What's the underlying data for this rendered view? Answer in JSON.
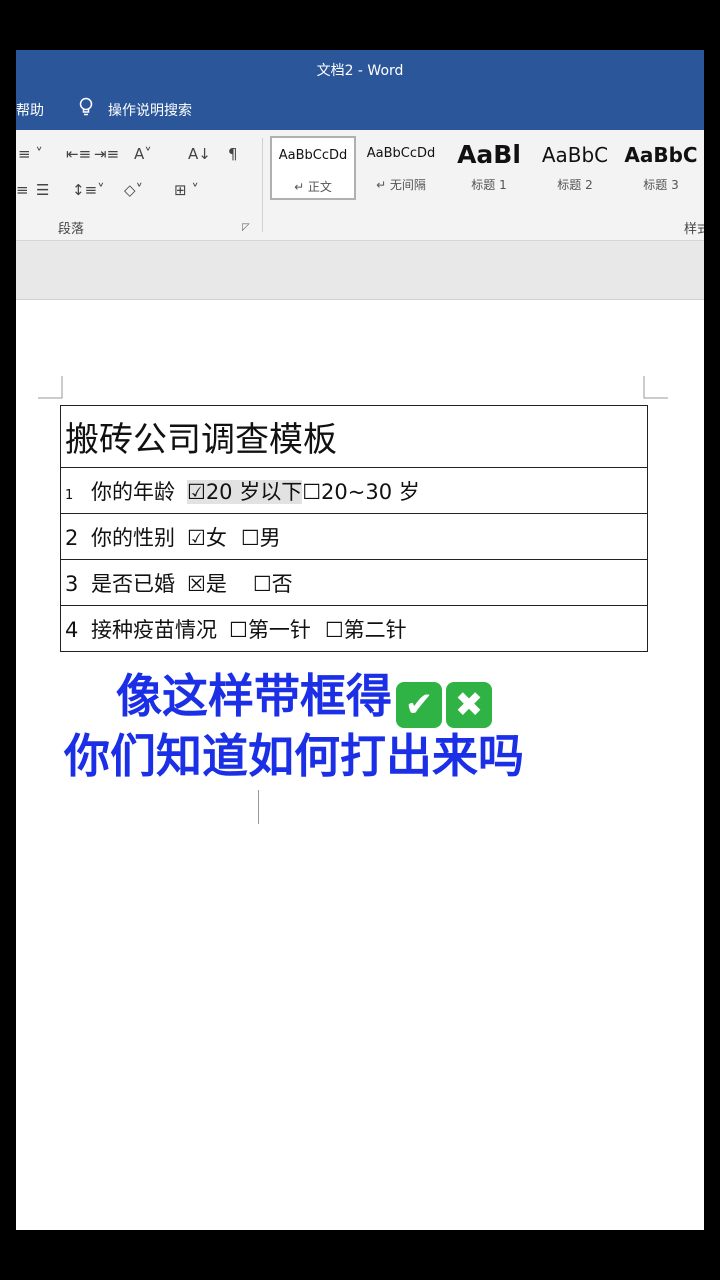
{
  "window": {
    "title": "文档2 - Word"
  },
  "menu": {
    "help_tab": "帮助",
    "tell_me": "操作说明搜索"
  },
  "paragraph_group": {
    "label": "段落"
  },
  "styles_gallery": {
    "group_label": "样式",
    "items": [
      {
        "preview": "AaBbCcDd",
        "name": "↵ 正文",
        "selected": true
      },
      {
        "preview": "AaBbCcDd",
        "name": "↵ 无间隔"
      },
      {
        "preview": "AaBl",
        "name": "标题 1"
      },
      {
        "preview": "AaBbC",
        "name": "标题 2"
      },
      {
        "preview": "AaBbC",
        "name": "标题 3"
      }
    ]
  },
  "document": {
    "table_title": "搬砖公司调查模板",
    "rows": [
      {
        "num": "1",
        "question": "你的年龄",
        "options": [
          "☑20 岁以下",
          "☐20~30 岁"
        ]
      },
      {
        "num": "2",
        "question": "你的性别",
        "options": [
          "☑女",
          "☐男"
        ]
      },
      {
        "num": "3",
        "question": "是否已婚",
        "options": [
          "☒是",
          "☐否"
        ]
      },
      {
        "num": "4",
        "question": "接种疫苗情况",
        "options": [
          "☐第一针",
          "☐第二针"
        ]
      }
    ]
  },
  "caption": {
    "line1": "像这样带框得",
    "emoji_check": "✔",
    "emoji_cross": "✖",
    "line2": "你们知道如何打出来吗"
  },
  "colors": {
    "title_bar": "#2b579a",
    "caption_blue": "#1a2fe6",
    "emoji_green": "#2fb344"
  }
}
